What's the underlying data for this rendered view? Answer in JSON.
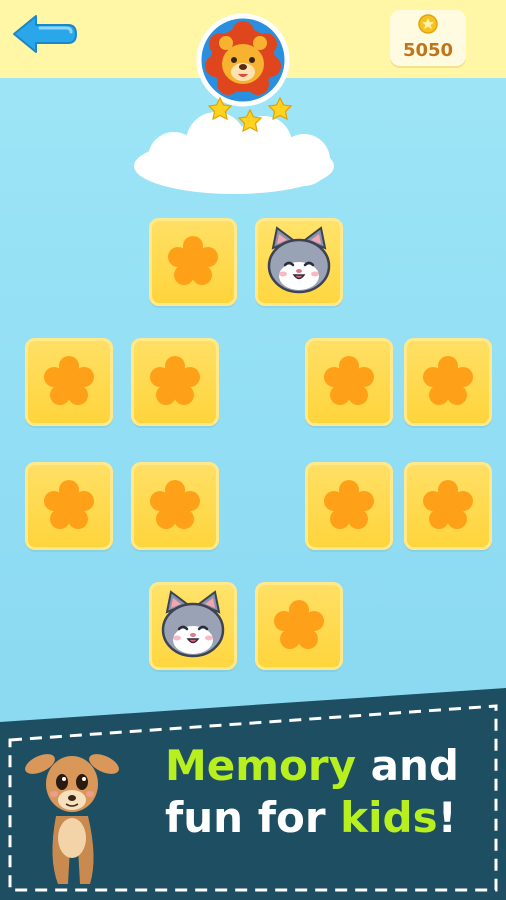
{
  "header": {
    "coins": "5050",
    "avatar": "lion-icon",
    "stars_earned": 3
  },
  "board": {
    "cards": [
      {
        "face": "flower-icon",
        "state": "hidden"
      },
      {
        "face": "cat-icon",
        "state": "revealed"
      },
      {
        "face": "flower-icon",
        "state": "hidden"
      },
      {
        "face": "flower-icon",
        "state": "hidden"
      },
      {
        "face": "flower-icon",
        "state": "hidden"
      },
      {
        "face": "flower-icon",
        "state": "hidden"
      },
      {
        "face": "flower-icon",
        "state": "hidden"
      },
      {
        "face": "flower-icon",
        "state": "hidden"
      },
      {
        "face": "flower-icon",
        "state": "hidden"
      },
      {
        "face": "flower-icon",
        "state": "hidden"
      },
      {
        "face": "cat-icon",
        "state": "revealed"
      },
      {
        "face": "flower-icon",
        "state": "hidden"
      }
    ]
  },
  "banner": {
    "word1": "Memory",
    "word2": "and",
    "word3": "fun for",
    "word4": "kids",
    "word5": "!",
    "mascot": "deer-icon"
  },
  "colors": {
    "card": "#ffd43b",
    "flower": "#ffa019",
    "banner": "#1d4e62",
    "accent_green": "#b7ef1f"
  }
}
